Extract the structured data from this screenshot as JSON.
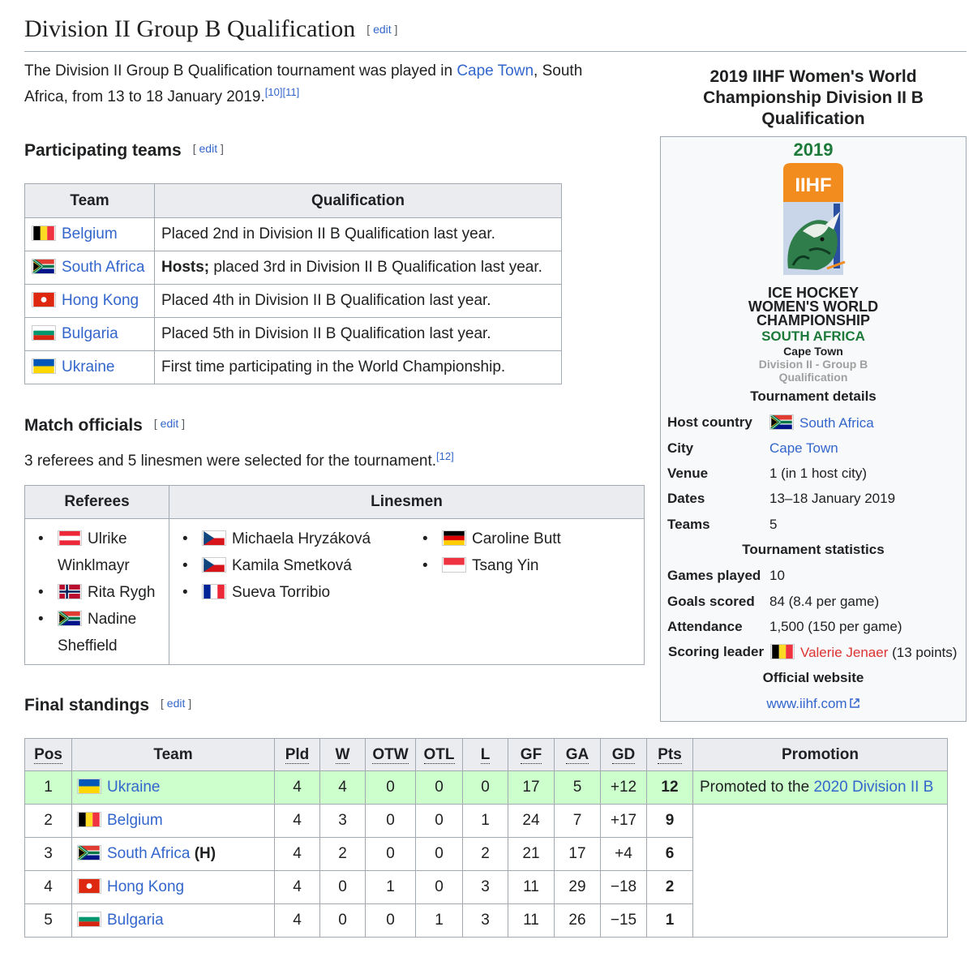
{
  "heading": {
    "title": "Division II Group B Qualification",
    "edit": "edit"
  },
  "intro": {
    "text1": "The Division II Group B Qualification tournament was played in ",
    "city_link": "Cape Town",
    "text2": ", South Africa, from 13 to 18 January 2019.",
    "refs": "[10][11]"
  },
  "participating": {
    "heading": "Participating teams",
    "edit": "edit",
    "columns": [
      "Team",
      "Qualification"
    ],
    "rows": [
      {
        "team": "Belgium",
        "flag": "belgium",
        "qual_bold": "",
        "qual": "Placed 2nd in Division II B Qualification last year."
      },
      {
        "team": "South Africa",
        "flag": "south-africa",
        "qual_bold": "Hosts;",
        "qual": " placed 3rd in Division II B Qualification last year."
      },
      {
        "team": "Hong Kong",
        "flag": "hong-kong",
        "qual_bold": "",
        "qual": "Placed 4th in Division II B Qualification last year."
      },
      {
        "team": "Bulgaria",
        "flag": "bulgaria",
        "qual_bold": "",
        "qual": "Placed 5th in Division II B Qualification last year."
      },
      {
        "team": "Ukraine",
        "flag": "ukraine",
        "qual_bold": "",
        "qual": "First time participating in the World Championship."
      }
    ]
  },
  "officials": {
    "heading": "Match officials",
    "edit": "edit",
    "text": "3 referees and 5 linesmen were selected for the tournament.",
    "ref": "[12]",
    "columns": [
      "Referees",
      "Linesmen"
    ],
    "referees": [
      {
        "name": "Ulrike Winklmayr",
        "flag": "austria"
      },
      {
        "name": "Rita Rygh",
        "flag": "norway"
      },
      {
        "name": "Nadine Sheffield",
        "flag": "south-africa"
      }
    ],
    "linesmen": [
      {
        "name": "Michaela Hryzáková",
        "flag": "czech-republic"
      },
      {
        "name": "Kamila Smetková",
        "flag": "czech-republic"
      },
      {
        "name": "Sueva Torribio",
        "flag": "france"
      },
      {
        "name": "Caroline Butt",
        "flag": "germany"
      },
      {
        "name": "Tsang Yin",
        "flag": "singapore"
      }
    ]
  },
  "standings": {
    "heading": "Final standings",
    "edit": "edit",
    "columns": [
      "Pos",
      "Team",
      "Pld",
      "W",
      "OTW",
      "OTL",
      "L",
      "GF",
      "GA",
      "GD",
      "Pts",
      "Promotion"
    ],
    "host_mark": "(H)",
    "promotion_text": "Promoted to the ",
    "promotion_link": "2020 Division II B",
    "rows": [
      {
        "pos": "1",
        "team": "Ukraine",
        "flag": "ukraine",
        "host": false,
        "pld": "4",
        "w": "4",
        "otw": "0",
        "otl": "0",
        "l": "0",
        "gf": "17",
        "ga": "5",
        "gd": "+12",
        "pts": "12"
      },
      {
        "pos": "2",
        "team": "Belgium",
        "flag": "belgium",
        "host": false,
        "pld": "4",
        "w": "3",
        "otw": "0",
        "otl": "0",
        "l": "1",
        "gf": "24",
        "ga": "7",
        "gd": "+17",
        "pts": "9"
      },
      {
        "pos": "3",
        "team": "South Africa",
        "flag": "south-africa",
        "host": true,
        "pld": "4",
        "w": "2",
        "otw": "0",
        "otl": "0",
        "l": "2",
        "gf": "21",
        "ga": "17",
        "gd": "+4",
        "pts": "6"
      },
      {
        "pos": "4",
        "team": "Hong Kong",
        "flag": "hong-kong",
        "host": false,
        "pld": "4",
        "w": "0",
        "otw": "1",
        "otl": "0",
        "l": "3",
        "gf": "11",
        "ga": "29",
        "gd": "−18",
        "pts": "2"
      },
      {
        "pos": "5",
        "team": "Bulgaria",
        "flag": "bulgaria",
        "host": false,
        "pld": "4",
        "w": "0",
        "otw": "0",
        "otl": "1",
        "l": "3",
        "gf": "11",
        "ga": "26",
        "gd": "−15",
        "pts": "1"
      }
    ]
  },
  "infobox": {
    "title": "2019 IIHF Women's World Championship Division II B Qualification",
    "logo": {
      "year": "2019",
      "brand": "IIHF",
      "line1": "ICE HOCKEY",
      "line2": "WOMEN'S WORLD",
      "line3": "CHAMPIONSHIP",
      "country": "SOUTH AFRICA",
      "city": "Cape Town",
      "division": "Division II - Group B",
      "qualification": "Qualification"
    },
    "tournament_details": "Tournament details",
    "host_country_label": "Host country",
    "host_country": "South Africa",
    "city_label": "City",
    "city": "Cape Town",
    "venue_label": "Venue",
    "venue": "1 (in 1 host city)",
    "dates_label": "Dates",
    "dates": "13–18 January 2019",
    "teams_label": "Teams",
    "teams": "5",
    "tournament_statistics": "Tournament statistics",
    "games_label": "Games played",
    "games": "10",
    "goals_label": "Goals scored",
    "goals": "84 (8.4 per game)",
    "attendance_label": "Attendance",
    "attendance": "1,500 (150 per game)",
    "leader_label": "Scoring leader",
    "leader": "Valerie Jenaer",
    "leader_points": "(13 points)",
    "official_website": "Official website",
    "website": "www.iihf.com"
  },
  "colors": {
    "link": "#3366cc",
    "redlink": "#dd3333",
    "header_bg": "#eaecf0",
    "promotion_bg": "#ccffcc",
    "logo_green": "#1d7a3a",
    "logo_orange": "#f28c1e"
  }
}
